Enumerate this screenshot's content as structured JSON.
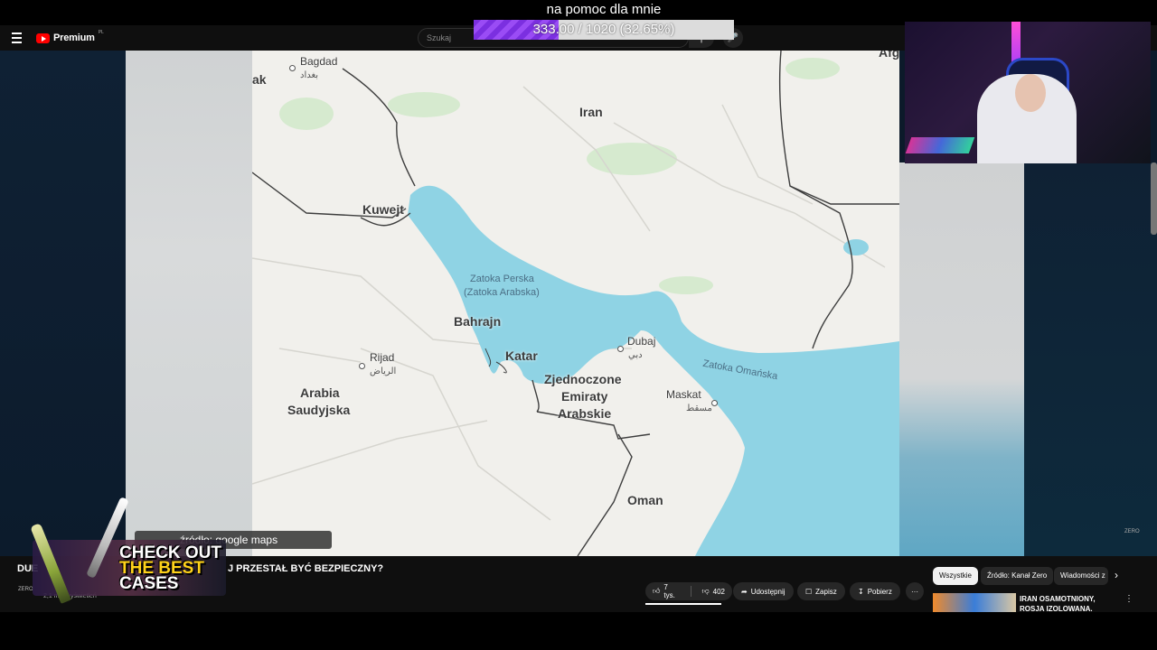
{
  "overlay": {
    "stream_title": "na pomoc dla mnie",
    "goal_text": "333.00 / 1020 (32.65%)",
    "goal_progress": 0.3265
  },
  "topbar": {
    "logo_text": "Premium",
    "logo_region": "PL",
    "search_placeholder": "Szukaj"
  },
  "map": {
    "labels": {
      "iran": "Iran",
      "kuwejt": "Kuwejt",
      "bahrajn": "Bahrajn",
      "katar": "Katar",
      "dubaj": "Dubaj",
      "zea_1": "Zjednoczone",
      "zea_2": "Emiraty",
      "zea_3": "Arabskie",
      "maskat": "Maskat",
      "arabia_1": "Arabia",
      "arabia_2": "Saudyjska",
      "oman": "Oman",
      "rijad": "Rijad",
      "bagdad": "Bagdad",
      "irak_partial": "ak",
      "afg_partial": "Afg",
      "zatoka_perska_1": "Zatoka Perska",
      "zatoka_perska_2": "(Zatoka Arabska)",
      "zatoka_omanska": "Zatoka Omańska",
      "bagdad_ar": "بغداد",
      "rijad_ar": "الرياض",
      "dubaj_ar": "دبي",
      "maskat_ar": "مسقط"
    },
    "colors": {
      "water": "#8fd3e4",
      "land": "#f1f0ec",
      "border": "#3e3e3e",
      "road": "#d9d8d3",
      "green": "#c8e6c3"
    }
  },
  "caption": "źródło: google maps",
  "watermark": "ZERO",
  "ad": {
    "line1": "CHECK OUT",
    "line2": "THE BEST",
    "line3": "CASES"
  },
  "video": {
    "title_left": "DUE",
    "title_right": "J PRZESTAŁ BYĆ BEZPIECZNY?",
    "channel_logo": "ZERO",
    "meta_partial": "2,1 mln wyświetleń"
  },
  "actions": {
    "likes": "7 tys.",
    "dislikes": "402",
    "share": "Udostępnij",
    "save": "Zapisz",
    "download": "Pobierz",
    "more": "···"
  },
  "chips": [
    "Wszystkie",
    "Źródło: Kanał Zero",
    "Wiadomości z"
  ],
  "recommendation": {
    "title": "IRAN OSAMOTNIONY, ROSJA IZOLOWANA. KONIEC KOŃCA ..."
  }
}
